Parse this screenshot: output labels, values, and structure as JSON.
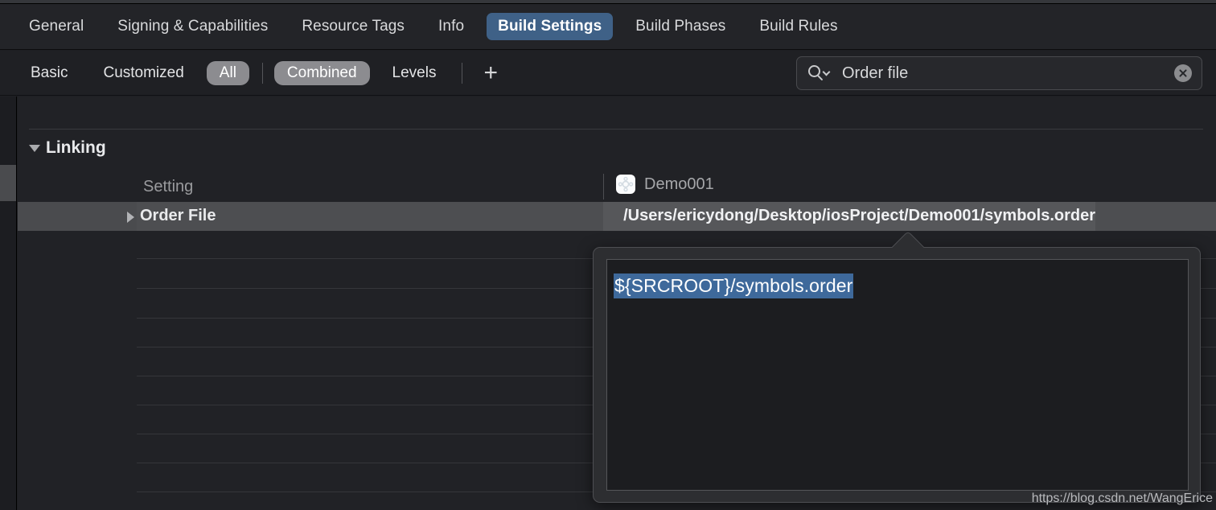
{
  "tabs": [
    {
      "label": "General",
      "active": false
    },
    {
      "label": "Signing & Capabilities",
      "active": false
    },
    {
      "label": "Resource Tags",
      "active": false
    },
    {
      "label": "Info",
      "active": false
    },
    {
      "label": "Build Settings",
      "active": true
    },
    {
      "label": "Build Phases",
      "active": false
    },
    {
      "label": "Build Rules",
      "active": false
    }
  ],
  "filter_bar": {
    "items": [
      {
        "label": "Basic",
        "selected": false
      },
      {
        "label": "Customized",
        "selected": false
      },
      {
        "label": "All",
        "selected": true
      }
    ],
    "view_items": [
      {
        "label": "Combined",
        "selected": true
      },
      {
        "label": "Levels",
        "selected": false
      }
    ],
    "add_label": "+"
  },
  "search": {
    "value": "Order file",
    "placeholder": "Search",
    "icon": "search-icon",
    "clear_icon": "clear-icon"
  },
  "group": {
    "title": "Linking",
    "expanded": true
  },
  "columns": {
    "setting": "Setting",
    "target": "Demo001"
  },
  "rows": [
    {
      "name": "Order File",
      "value": "/Users/ericydong/Desktop/iosProject/Demo001/symbols.order",
      "selected": true,
      "expandable": true
    }
  ],
  "empty_row_count": 9,
  "popover": {
    "value": "${SRCROOT}/symbols.order",
    "selected": true
  },
  "watermark": "https://blog.csdn.net/WangErice",
  "colors": {
    "accent_tab": "#3f6187",
    "pill": "#8c8c90",
    "selection": "#3e699b",
    "row_selected": "#4d4e51",
    "background": "#1e1f23"
  }
}
